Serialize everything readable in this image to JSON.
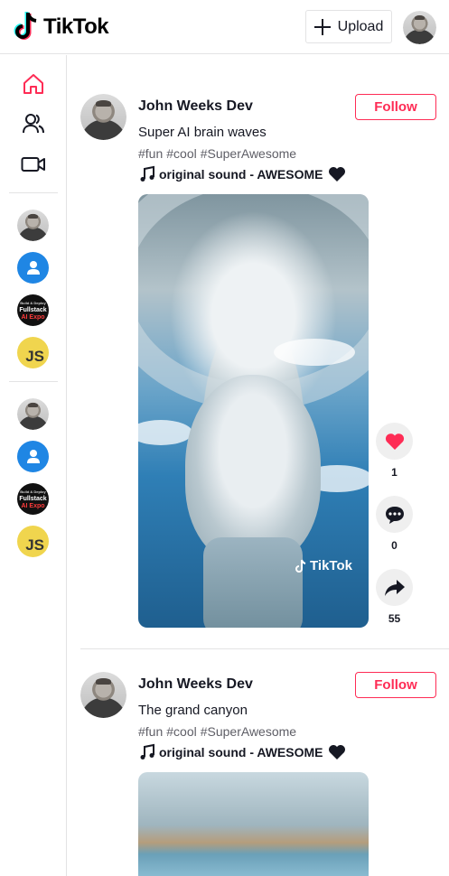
{
  "header": {
    "logo_text": "TikTok",
    "upload_label": "Upload"
  },
  "sidebar": {
    "nav": [
      {
        "name": "home",
        "icon": "home-icon",
        "active": true
      },
      {
        "name": "following",
        "icon": "users-icon",
        "active": false
      },
      {
        "name": "live",
        "icon": "video-camera-icon",
        "active": false
      }
    ],
    "suggested_avatars": [
      "john-weeks-avatar",
      "default-user-avatar",
      "fullstack-aiexpo-avatar",
      "js-avatar"
    ],
    "following_avatars": [
      "john-weeks-avatar",
      "default-user-avatar",
      "fullstack-aiexpo-avatar",
      "js-avatar"
    ],
    "fullstack_avatar_text": {
      "line1": "Build & Deploy",
      "line2": "Fullstack",
      "line3": "AI Expo"
    },
    "js_avatar_text": "JS"
  },
  "posts": [
    {
      "author": "John Weeks Dev",
      "follow_label": "Follow",
      "caption": "Super AI brain waves",
      "tags": [
        "#fun",
        "#cool",
        "#SuperAwesome"
      ],
      "sound": "original sound - AWESOME",
      "watermark": "TikTok",
      "likes": "1",
      "comments": "0",
      "shares": "55"
    },
    {
      "author": "John Weeks Dev",
      "follow_label": "Follow",
      "caption": "The grand canyon",
      "tags": [
        "#fun",
        "#cool",
        "#SuperAwesome"
      ],
      "sound": "original sound - AWESOME"
    }
  ],
  "colors": {
    "accent": "#fe2c55",
    "text": "#161823",
    "muted": "#5e5e66",
    "border": "#e3e3e4",
    "action_bg": "#efefef"
  }
}
